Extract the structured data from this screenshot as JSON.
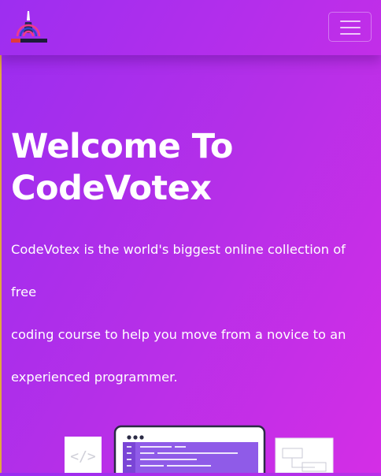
{
  "navbar": {
    "brand_logo": "codevotex-logo-icon",
    "toggler_icon": "hamburger-menu-icon"
  },
  "hero": {
    "title_line1": "Welcome To",
    "title_line2": "CodeVotex",
    "text_line1": "CodeVotex is the world's biggest online collection of free",
    "text_line2": "coding course to help you move from a novice to an",
    "text_line3": "experienced programmer."
  },
  "illustration": {
    "left_card_glyph": "</>"
  },
  "colors": {
    "background_start": "#9a2df0",
    "background_end": "#d42ee6",
    "text": "#ffffff"
  }
}
